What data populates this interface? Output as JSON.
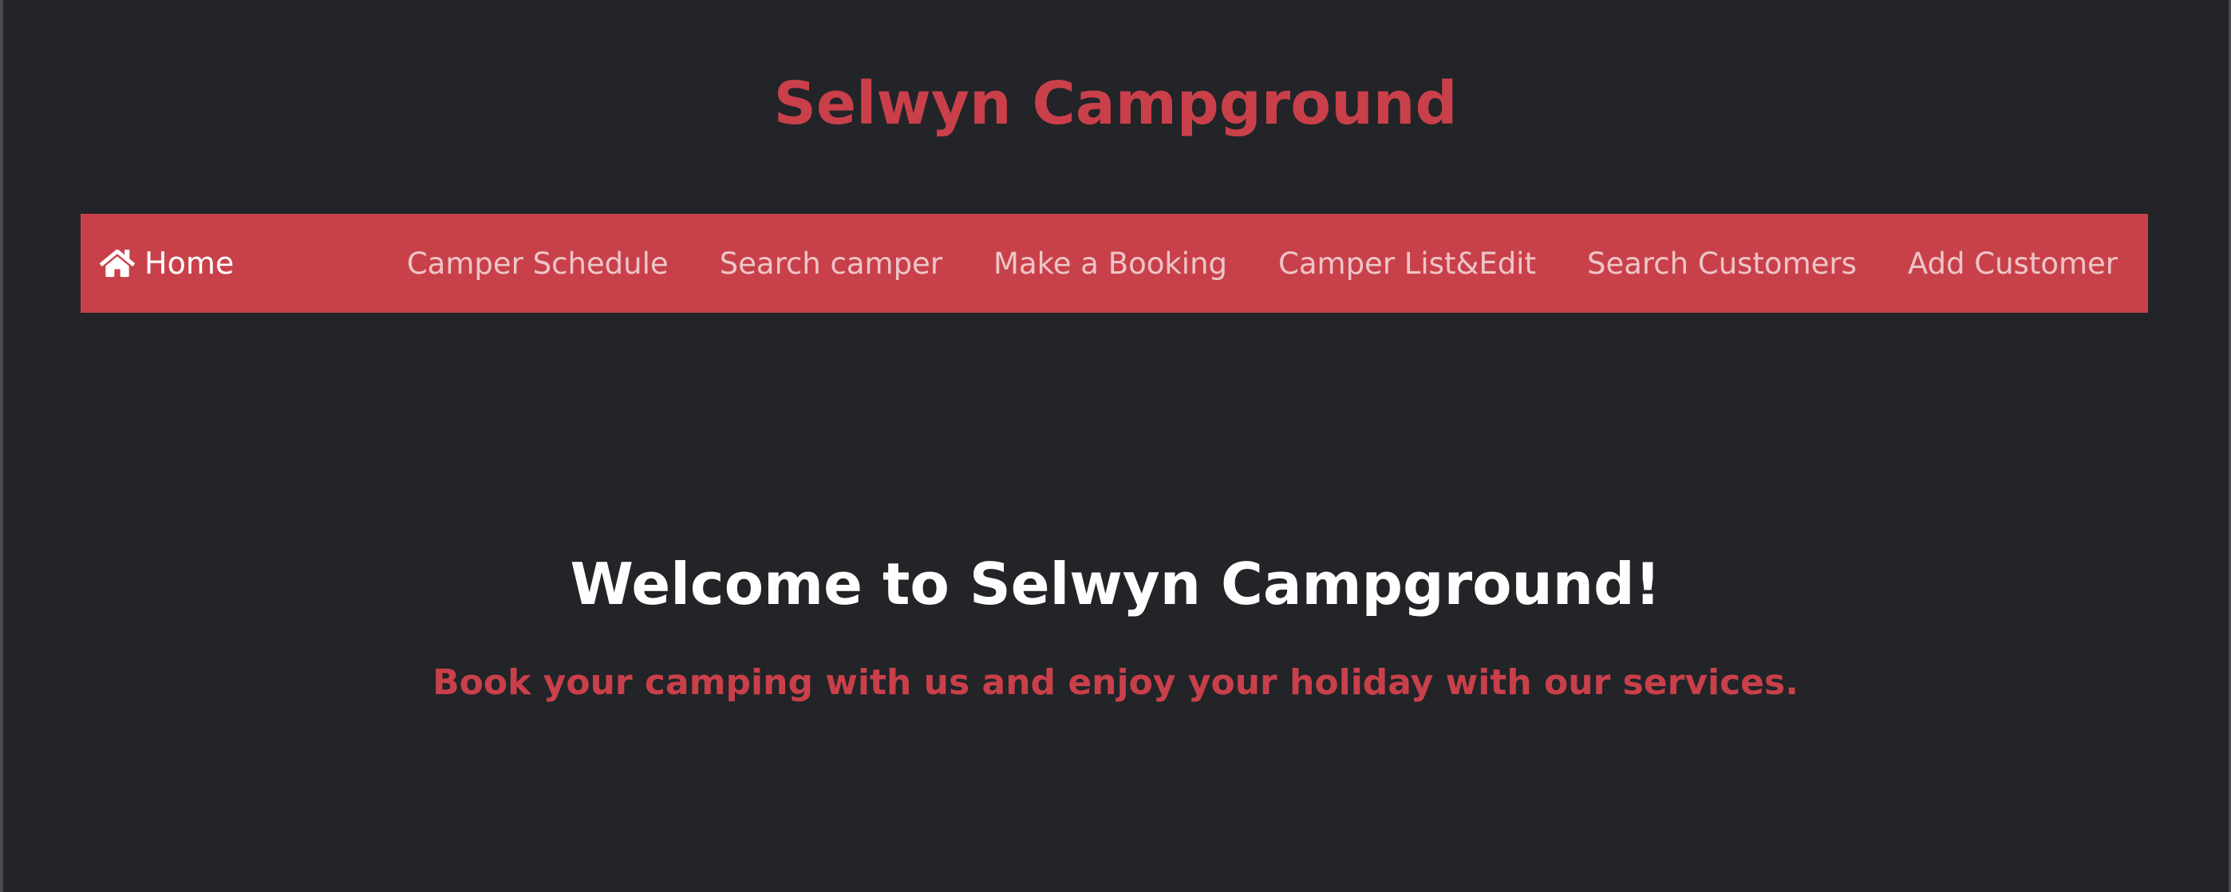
{
  "site": {
    "title": "Selwyn Campground"
  },
  "navbar": {
    "brand": {
      "icon": "home-icon",
      "label": "Home"
    },
    "links": [
      {
        "label": "Camper Schedule"
      },
      {
        "label": "Search camper"
      },
      {
        "label": "Make a Booking"
      },
      {
        "label": "Camper List&Edit"
      },
      {
        "label": "Search Customers"
      },
      {
        "label": "Add Customer"
      }
    ]
  },
  "hero": {
    "title": "Welcome to Selwyn Campground!",
    "subtitle": "Book your camping with us and enjoy your holiday with our services."
  },
  "colors": {
    "background": "#222428",
    "accent": "#c8414a",
    "nav_link": "#eec5c8",
    "heading": "#ffffff"
  }
}
